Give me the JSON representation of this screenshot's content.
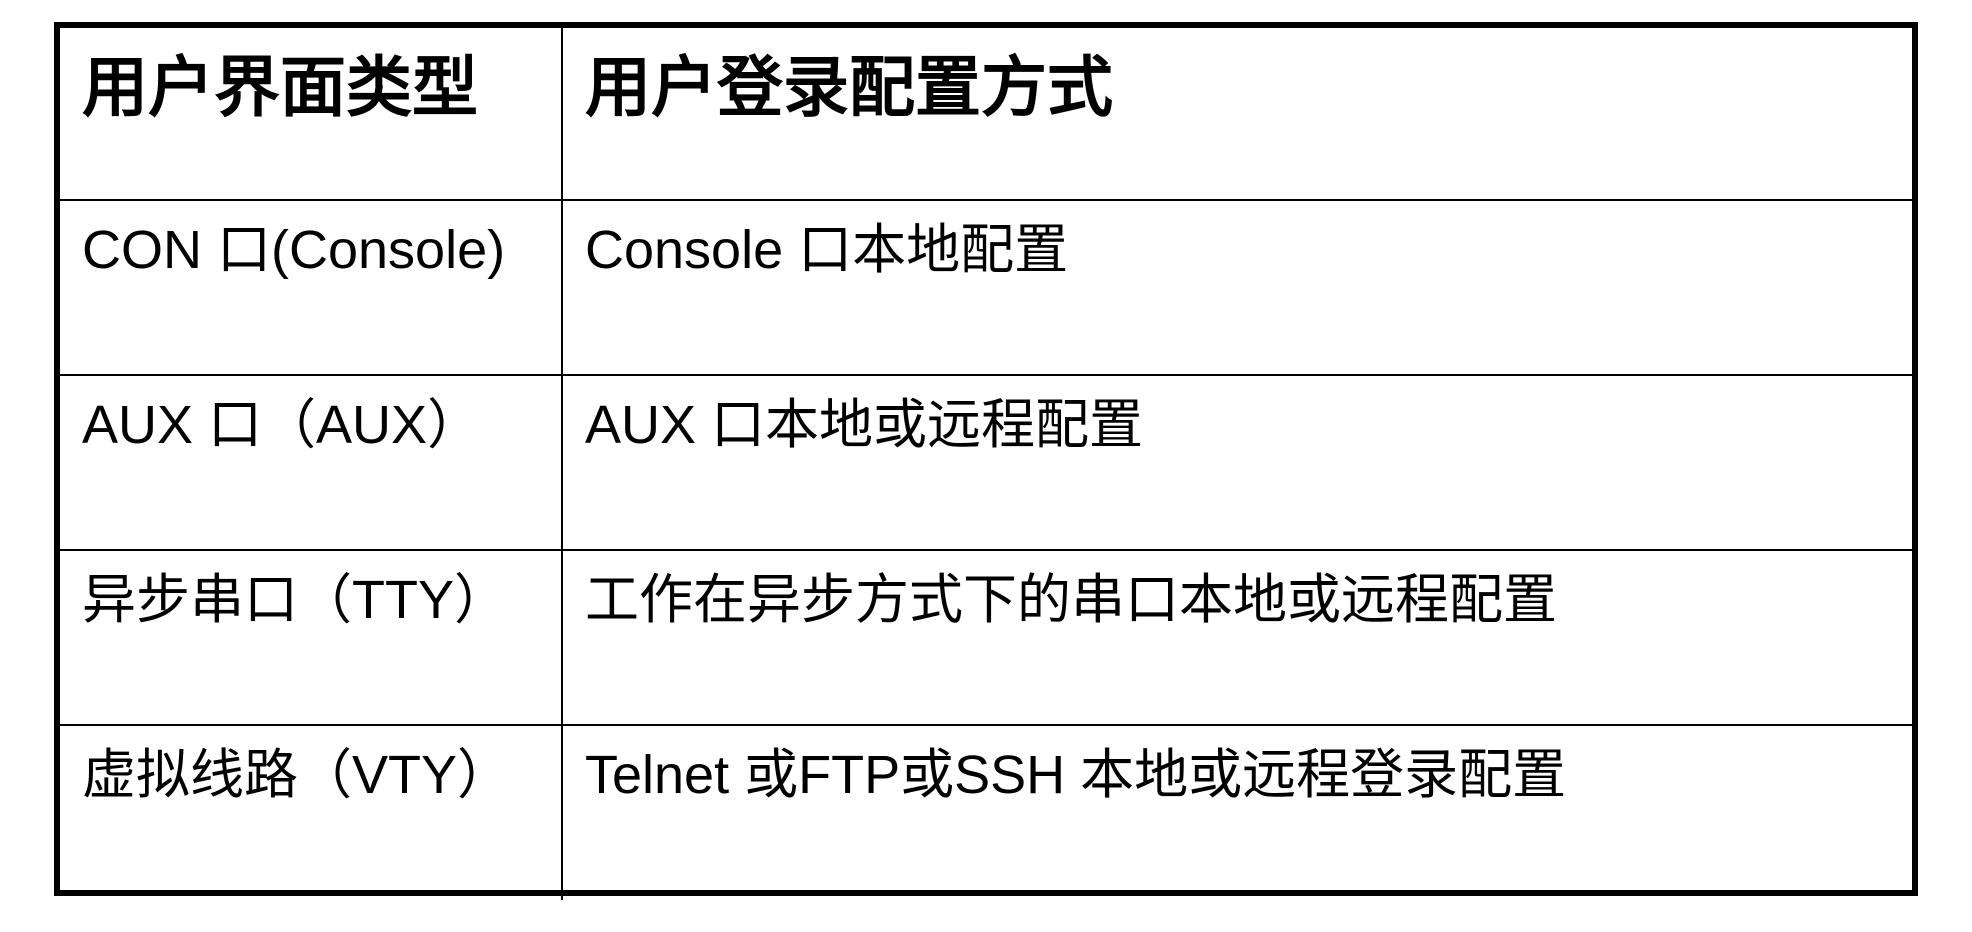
{
  "table": {
    "headers": [
      "用户界面类型",
      "用户登录配置方式"
    ],
    "rows": [
      [
        "CON 口(Console)",
        "Console 口本地配置"
      ],
      [
        "AUX 口（AUX）",
        "AUX 口本地或远程配置"
      ],
      [
        "异步串口（TTY）",
        "工作在异步方式下的串口本地或远程配置"
      ],
      [
        "虚拟线路（VTY）",
        "Telnet 或FTP或SSH 本地或远程登录配置"
      ]
    ]
  }
}
